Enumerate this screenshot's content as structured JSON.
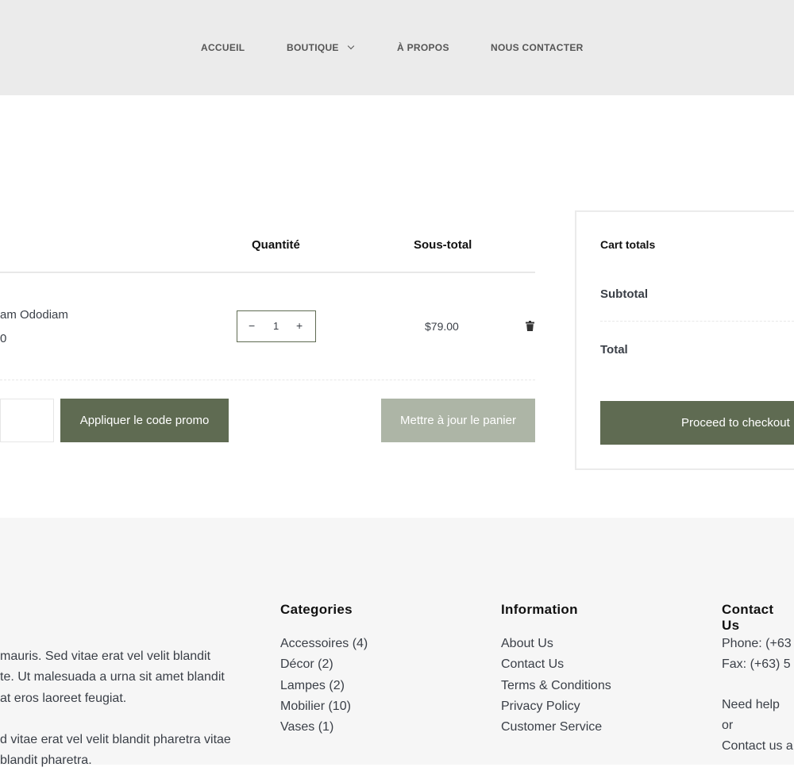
{
  "nav": {
    "items": [
      "ACCUEIL",
      "BOUTIQUE",
      "À PROPOS",
      "NOUS CONTACTER"
    ]
  },
  "cart": {
    "headers": {
      "quantity": "Quantité",
      "subtotal": "Sous-total"
    },
    "item": {
      "name": "am Ododiam",
      "price": "0",
      "quantity": "1",
      "subtotal": "$79.00"
    },
    "apply_coupon": "Appliquer le code promo",
    "coupon_placeholder": "",
    "update_cart": "Mettre à jour le panier"
  },
  "totals": {
    "title": "Cart totals",
    "subtotal_label": "Subtotal",
    "total_label": "Total",
    "checkout": "Proceed to checkout"
  },
  "footer": {
    "about_lines": [
      " mauris. Sed vitae erat vel velit blandit",
      "te. Ut malesuada a urna sit amet blandit",
      " at eros laoreet feugiat.",
      "",
      "d vitae erat vel velit blandit pharetra vitae",
      "blandit pharetra."
    ],
    "categories": {
      "title": "Categories",
      "items": [
        "Accessoires (4)",
        "Décor (2)",
        "Lampes (2)",
        "Mobilier (10)",
        "Vases (1)"
      ]
    },
    "information": {
      "title": "Information",
      "items": [
        "About Us",
        "Contact Us",
        "Terms & Conditions",
        "Privacy Policy",
        "Customer Service"
      ]
    },
    "contact": {
      "title": "Contact Us",
      "lines": [
        "Phone: (+63",
        "Fax: (+63) 5",
        "",
        "Need help or",
        "Contact us a"
      ]
    }
  },
  "colors": {
    "accent": "#5f6b52",
    "accent_light": "#adb5a6",
    "header_bg": "#ebebeb",
    "footer_bg": "#f6f6f6"
  }
}
